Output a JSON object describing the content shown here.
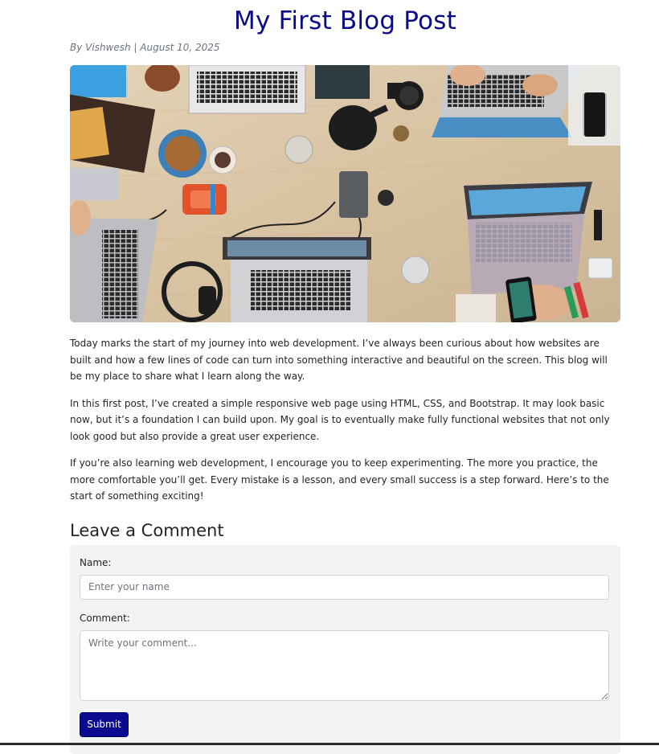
{
  "post": {
    "title": "My First Blog Post",
    "meta": "By Vishwesh | August 10, 2025",
    "image_alt": "Desk with laptops, notebooks, phones, headphones and coffee seen from above",
    "paragraphs": [
      "Today marks the start of my journey into web development. I’ve always been curious about how websites are built and how a few lines of code can turn into something interactive and beautiful on the screen. This blog will be my place to share what I learn along the way.",
      "In this first post, I’ve created a simple responsive web page using HTML, CSS, and Bootstrap. It may look basic now, but it’s a foundation I can build upon. My goal is to eventually make fully functional websites that not only look good but also provide a great user experience.",
      "If you’re also learning web development, I encourage you to keep experimenting. The more you practice, the more comfortable you’ll get. Every mistake is a lesson, and every small success is a step forward. Here’s to the start of something exciting!"
    ]
  },
  "comments": {
    "heading": "Leave a Comment",
    "name_label": "Name:",
    "name_placeholder": "Enter your name",
    "name_value": "",
    "comment_label": "Comment:",
    "comment_placeholder": "Write your comment...",
    "comment_value": "",
    "submit_label": "Submit"
  },
  "colors": {
    "title": "#0b0b86",
    "button": "#0b0b8f",
    "form_background": "#f3f3f3"
  }
}
